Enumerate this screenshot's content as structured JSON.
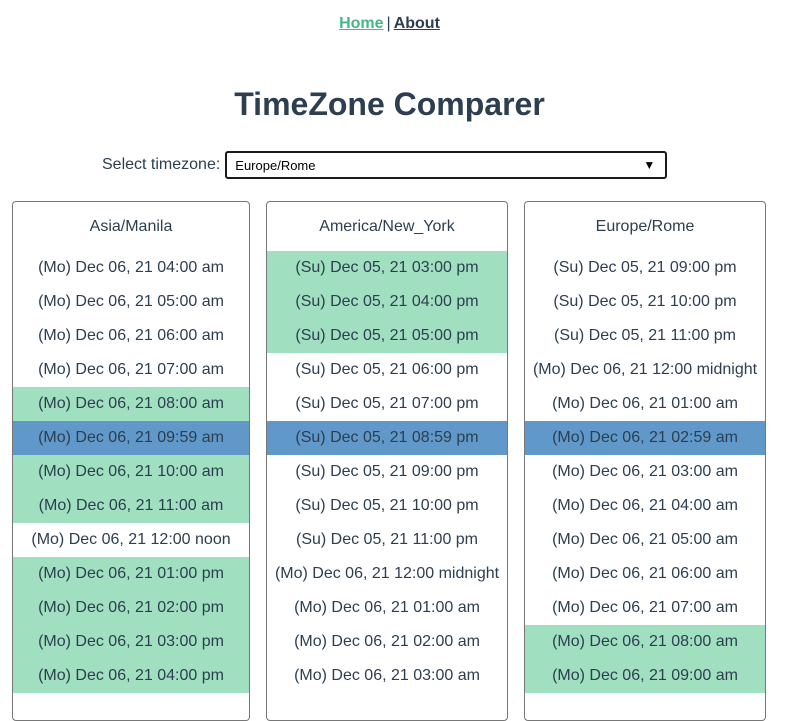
{
  "nav": {
    "home_label": "Home",
    "separator": "|",
    "about_label": "About"
  },
  "title": "TimeZone Comparer",
  "selector": {
    "label": "Select timezone:",
    "selected": "Europe/Rome"
  },
  "colors": {
    "work_hours": "#a0e0c0",
    "current_hour": "#6099c9",
    "accent": "#42b983",
    "text": "#2c3e50"
  },
  "columns": [
    {
      "zone": "Asia/Manila",
      "rows": [
        {
          "text": "(Mo) Dec 06, 21 04:00 am",
          "state": "normal"
        },
        {
          "text": "(Mo) Dec 06, 21 05:00 am",
          "state": "normal"
        },
        {
          "text": "(Mo) Dec 06, 21 06:00 am",
          "state": "normal"
        },
        {
          "text": "(Mo) Dec 06, 21 07:00 am",
          "state": "normal"
        },
        {
          "text": "(Mo) Dec 06, 21 08:00 am",
          "state": "work"
        },
        {
          "text": "(Mo) Dec 06, 21 09:59 am",
          "state": "current"
        },
        {
          "text": "(Mo) Dec 06, 21 10:00 am",
          "state": "work"
        },
        {
          "text": "(Mo) Dec 06, 21 11:00 am",
          "state": "work"
        },
        {
          "text": "(Mo) Dec 06, 21 12:00 noon",
          "state": "normal"
        },
        {
          "text": "(Mo) Dec 06, 21 01:00 pm",
          "state": "work"
        },
        {
          "text": "(Mo) Dec 06, 21 02:00 pm",
          "state": "work"
        },
        {
          "text": "(Mo) Dec 06, 21 03:00 pm",
          "state": "work"
        },
        {
          "text": "(Mo) Dec 06, 21 04:00 pm",
          "state": "work"
        }
      ]
    },
    {
      "zone": "America/New_York",
      "rows": [
        {
          "text": "(Su) Dec 05, 21 03:00 pm",
          "state": "work"
        },
        {
          "text": "(Su) Dec 05, 21 04:00 pm",
          "state": "work"
        },
        {
          "text": "(Su) Dec 05, 21 05:00 pm",
          "state": "work"
        },
        {
          "text": "(Su) Dec 05, 21 06:00 pm",
          "state": "normal"
        },
        {
          "text": "(Su) Dec 05, 21 07:00 pm",
          "state": "normal"
        },
        {
          "text": "(Su) Dec 05, 21 08:59 pm",
          "state": "current"
        },
        {
          "text": "(Su) Dec 05, 21 09:00 pm",
          "state": "normal"
        },
        {
          "text": "(Su) Dec 05, 21 10:00 pm",
          "state": "normal"
        },
        {
          "text": "(Su) Dec 05, 21 11:00 pm",
          "state": "normal"
        },
        {
          "text": "(Mo) Dec 06, 21 12:00 midnight",
          "state": "normal"
        },
        {
          "text": "(Mo) Dec 06, 21 01:00 am",
          "state": "normal"
        },
        {
          "text": "(Mo) Dec 06, 21 02:00 am",
          "state": "normal"
        },
        {
          "text": "(Mo) Dec 06, 21 03:00 am",
          "state": "normal"
        }
      ]
    },
    {
      "zone": "Europe/Rome",
      "rows": [
        {
          "text": "(Su) Dec 05, 21 09:00 pm",
          "state": "normal"
        },
        {
          "text": "(Su) Dec 05, 21 10:00 pm",
          "state": "normal"
        },
        {
          "text": "(Su) Dec 05, 21 11:00 pm",
          "state": "normal"
        },
        {
          "text": "(Mo) Dec 06, 21 12:00 midnight",
          "state": "normal"
        },
        {
          "text": "(Mo) Dec 06, 21 01:00 am",
          "state": "normal"
        },
        {
          "text": "(Mo) Dec 06, 21 02:59 am",
          "state": "current"
        },
        {
          "text": "(Mo) Dec 06, 21 03:00 am",
          "state": "normal"
        },
        {
          "text": "(Mo) Dec 06, 21 04:00 am",
          "state": "normal"
        },
        {
          "text": "(Mo) Dec 06, 21 05:00 am",
          "state": "normal"
        },
        {
          "text": "(Mo) Dec 06, 21 06:00 am",
          "state": "normal"
        },
        {
          "text": "(Mo) Dec 06, 21 07:00 am",
          "state": "normal"
        },
        {
          "text": "(Mo) Dec 06, 21 08:00 am",
          "state": "work"
        },
        {
          "text": "(Mo) Dec 06, 21 09:00 am",
          "state": "work"
        }
      ]
    }
  ]
}
